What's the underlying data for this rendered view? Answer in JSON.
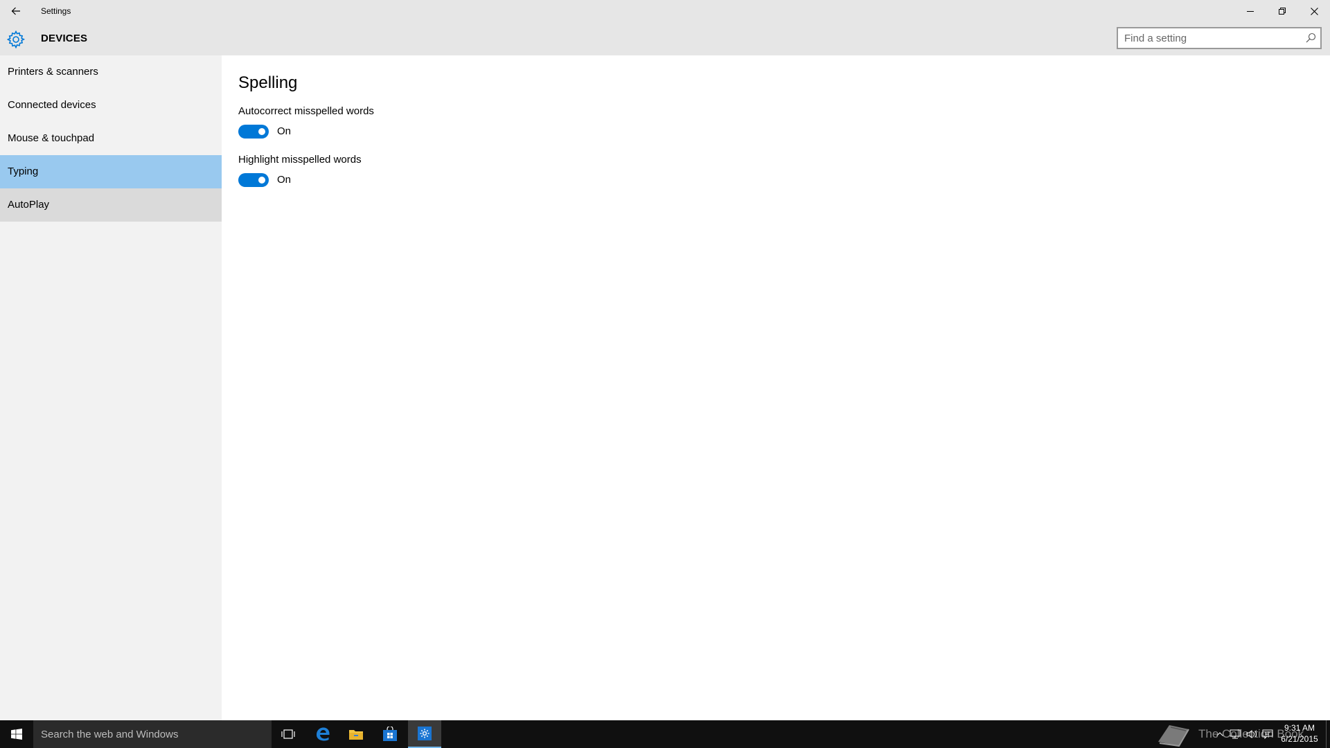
{
  "window": {
    "title": "Settings",
    "back_icon": "arrow-left-icon",
    "controls": [
      "minimize-icon",
      "restore-icon",
      "close-icon"
    ]
  },
  "header": {
    "icon": "gear-icon",
    "title": "DEVICES",
    "search_placeholder": "Find a setting",
    "search_icon": "search-icon"
  },
  "sidebar": {
    "items": [
      {
        "label": "Printers & scanners",
        "state": "normal"
      },
      {
        "label": "Connected devices",
        "state": "normal"
      },
      {
        "label": "Mouse & touchpad",
        "state": "normal"
      },
      {
        "label": "Typing",
        "state": "selected"
      },
      {
        "label": "AutoPlay",
        "state": "hover"
      }
    ]
  },
  "main": {
    "section_title": "Spelling",
    "settings": [
      {
        "label": "Autocorrect misspelled words",
        "toggle_state": "On",
        "on": true
      },
      {
        "label": "Highlight misspelled words",
        "toggle_state": "On",
        "on": true
      }
    ]
  },
  "taskbar": {
    "search_placeholder": "Search the web and Windows",
    "apps": [
      "task-view-icon",
      "edge-icon",
      "file-explorer-icon",
      "store-icon",
      "settings-icon"
    ],
    "active_app": "settings-icon",
    "watermark": "The Collection Book",
    "clock_time": "9:31 AM",
    "clock_date": "6/21/2015"
  },
  "colors": {
    "accent": "#0078d7",
    "selected_nav": "#99c9ef",
    "hover_nav": "#dadada",
    "sidebar_bg": "#f2f2f2",
    "header_bg": "#e6e6e6",
    "taskbar_bg": "#101010"
  }
}
